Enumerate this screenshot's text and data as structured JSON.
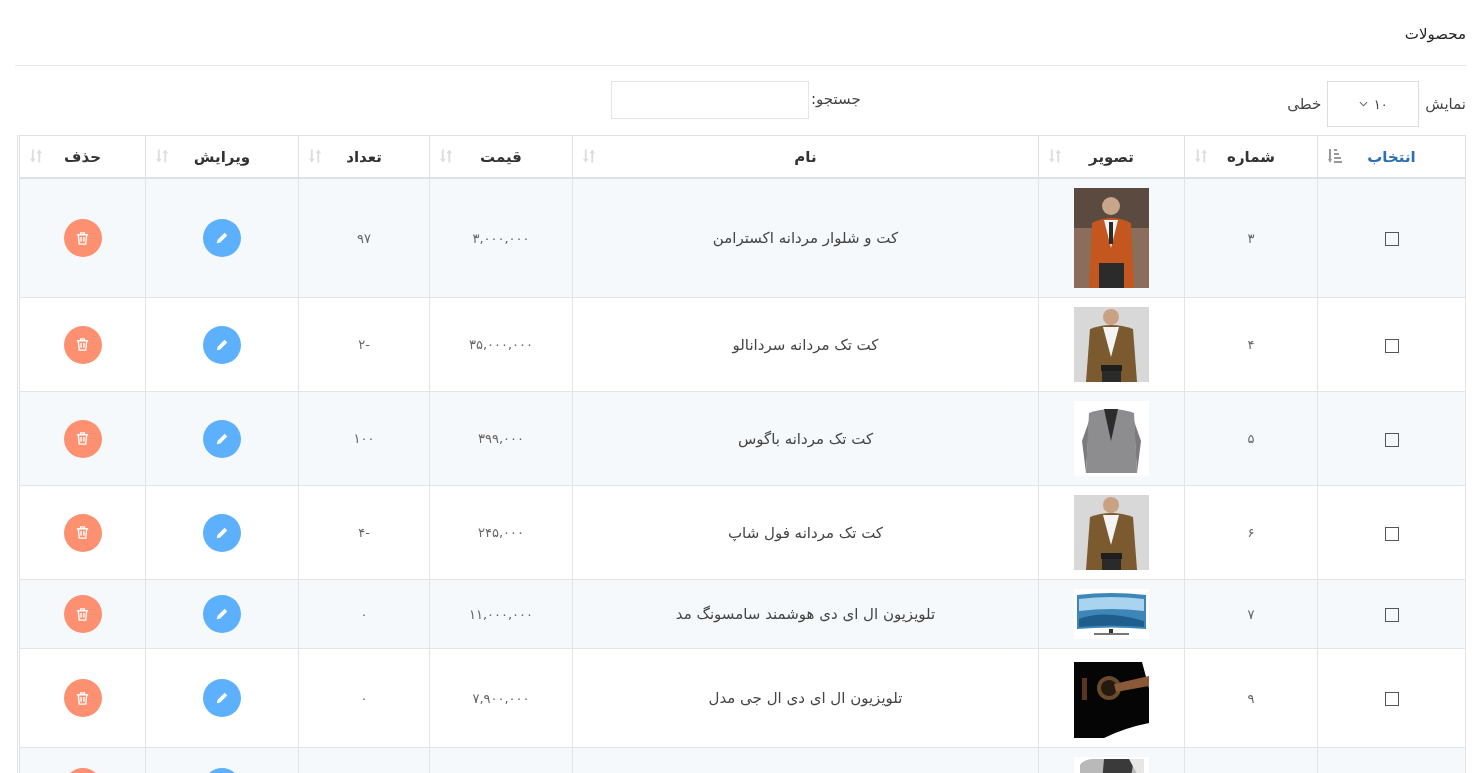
{
  "page_title": "محصولات",
  "length_control": {
    "label_before": "نمایش",
    "value": "۱۰",
    "label_after": "خطی"
  },
  "search": {
    "label": "جستجو:"
  },
  "table": {
    "columns": [
      {
        "label": "انتخاب",
        "sorted": true
      },
      {
        "label": "شماره",
        "sorted": false
      },
      {
        "label": "تصویر",
        "sorted": false
      },
      {
        "label": "نام",
        "sorted": false
      },
      {
        "label": "قیمت",
        "sorted": false
      },
      {
        "label": "تعداد",
        "sorted": false
      },
      {
        "label": "ویرایش",
        "sorted": false
      },
      {
        "label": "حذف",
        "sorted": false
      }
    ],
    "rows": [
      {
        "checked": false,
        "number": "۳",
        "name": "کت و شلوار مردانه اکسترامن",
        "price": "۳,۰۰۰,۰۰۰",
        "quantity": "۹۷"
      },
      {
        "checked": false,
        "number": "۴",
        "name": "کت تک مردانه سردانالو",
        "price": "۳۵,۰۰۰,۰۰۰",
        "quantity": "-۲"
      },
      {
        "checked": false,
        "number": "۵",
        "name": "کت تک مردانه باگوس",
        "price": "۳۹۹,۰۰۰",
        "quantity": "۱۰۰"
      },
      {
        "checked": false,
        "number": "۶",
        "name": "کت تک مردانه فول شاپ",
        "price": "۲۴۵,۰۰۰",
        "quantity": "-۴"
      },
      {
        "checked": false,
        "number": "۷",
        "name": "تلویزیون ال ای دی هوشمند سامسونگ مد",
        "price": "۱۱,۰۰۰,۰۰۰",
        "quantity": "۰"
      },
      {
        "checked": false,
        "number": "۹",
        "name": "تلویزیون ال ای دی ال جی مدل",
        "price": "۷,۹۰۰,۰۰۰",
        "quantity": "۰"
      }
    ],
    "more_rows_below": true
  }
}
